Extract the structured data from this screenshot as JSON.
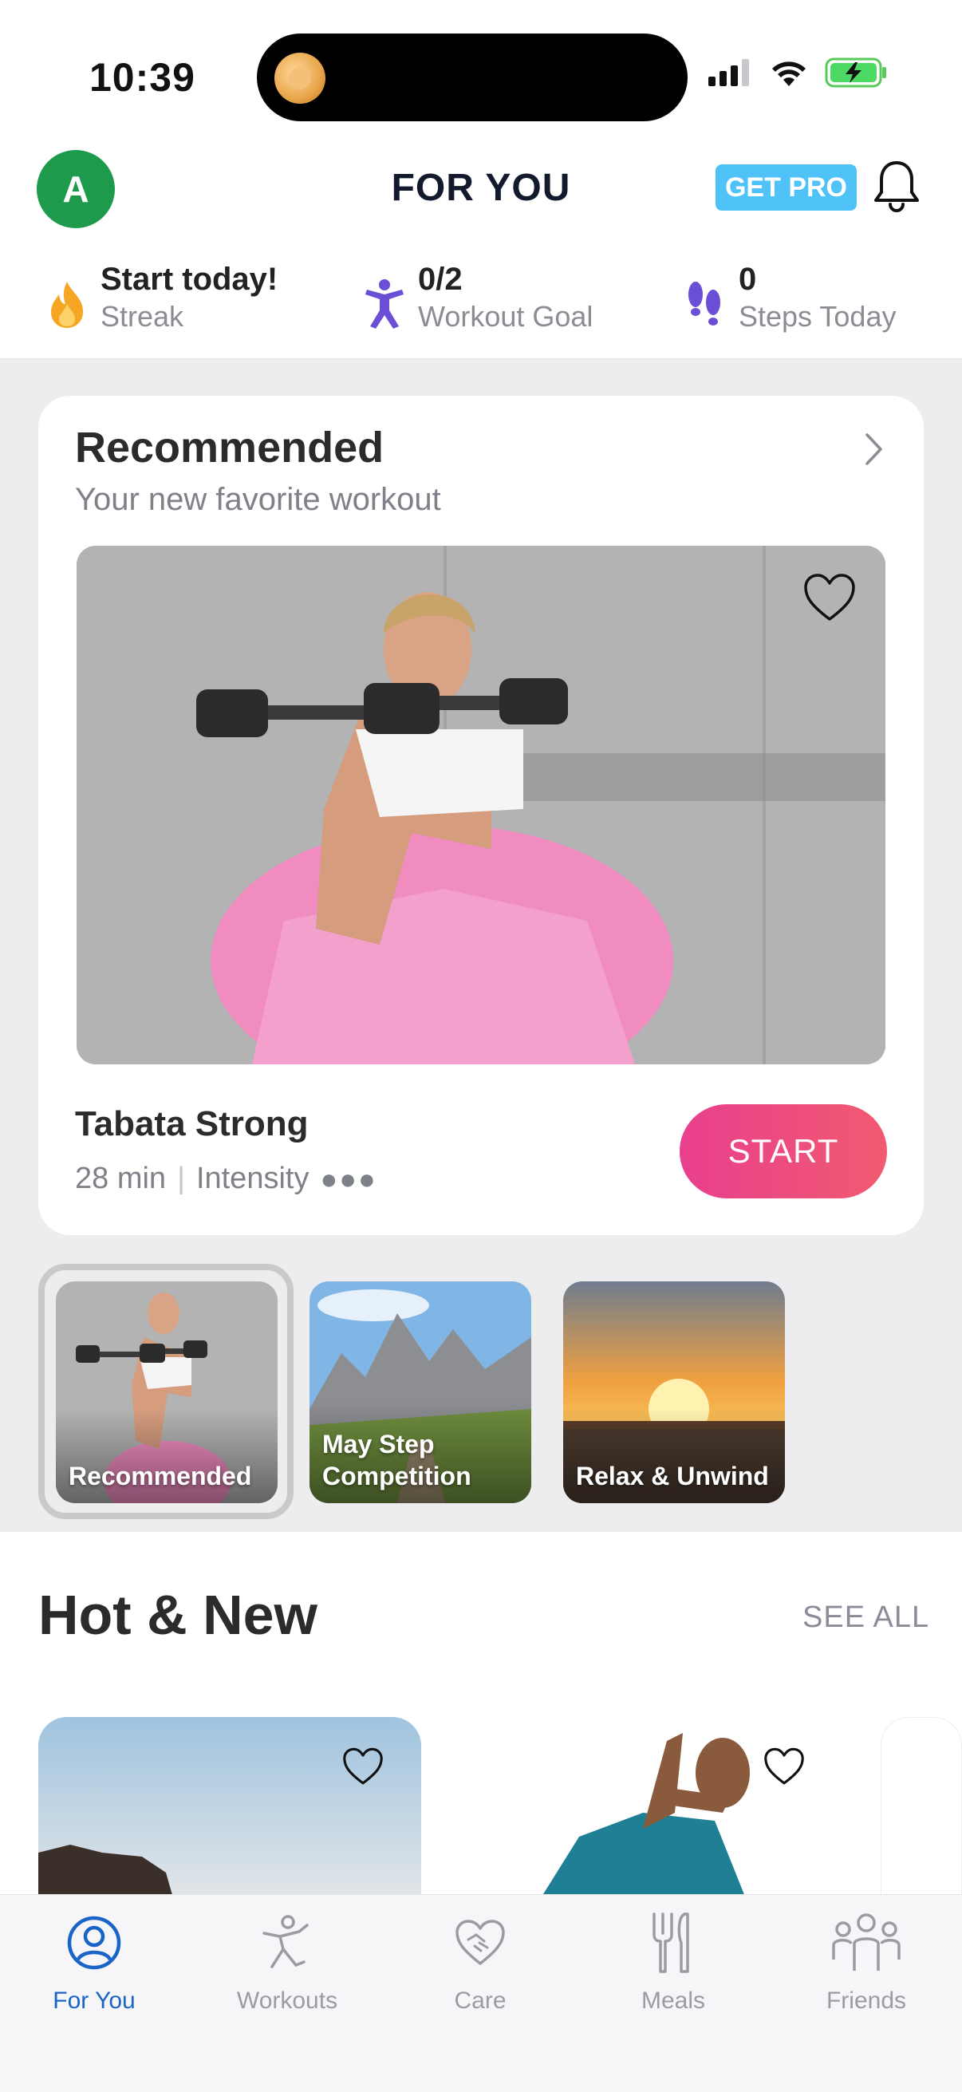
{
  "status_bar": {
    "time": "10:39"
  },
  "header": {
    "avatar_initial": "A",
    "title": "FOR YOU",
    "get_pro_label": "GET PRO",
    "colors": {
      "avatar": "#1d9a4c",
      "get_pro": "#4fc3f7"
    }
  },
  "stats": [
    {
      "value": "Start today!",
      "label": "Streak",
      "icon": "flame-icon"
    },
    {
      "value": "0/2",
      "label": "Workout Goal",
      "icon": "person-exercise-icon"
    },
    {
      "value": "0",
      "label": "Steps Today",
      "icon": "footsteps-icon"
    }
  ],
  "recommended": {
    "title": "Recommended",
    "subtitle": "Your new favorite workout",
    "workout_name": "Tabata Strong",
    "duration": "28 min",
    "intensity_label": "Intensity",
    "intensity_dots": "●●●",
    "start_label": "START",
    "colors": {
      "start_gradient_from": "#e83f8e",
      "start_gradient_to": "#f25a70"
    }
  },
  "carousel": [
    {
      "label": "Recommended",
      "selected": true
    },
    {
      "label": "May Step Competition",
      "selected": false
    },
    {
      "label": "Relax & Unwind",
      "selected": false
    }
  ],
  "hot_new": {
    "title": "Hot & New",
    "see_all_label": "SEE ALL"
  },
  "tab_bar": {
    "tabs": [
      {
        "label": "For You",
        "icon": "person-circle-icon",
        "active": true
      },
      {
        "label": "Workouts",
        "icon": "stretching-person-icon",
        "active": false
      },
      {
        "label": "Care",
        "icon": "heart-handshake-icon",
        "active": false
      },
      {
        "label": "Meals",
        "icon": "fork-knife-icon",
        "active": false
      },
      {
        "label": "Friends",
        "icon": "group-icon",
        "active": false
      }
    ],
    "colors": {
      "active": "#1a64c8",
      "inactive": "#9a9ca3"
    }
  }
}
